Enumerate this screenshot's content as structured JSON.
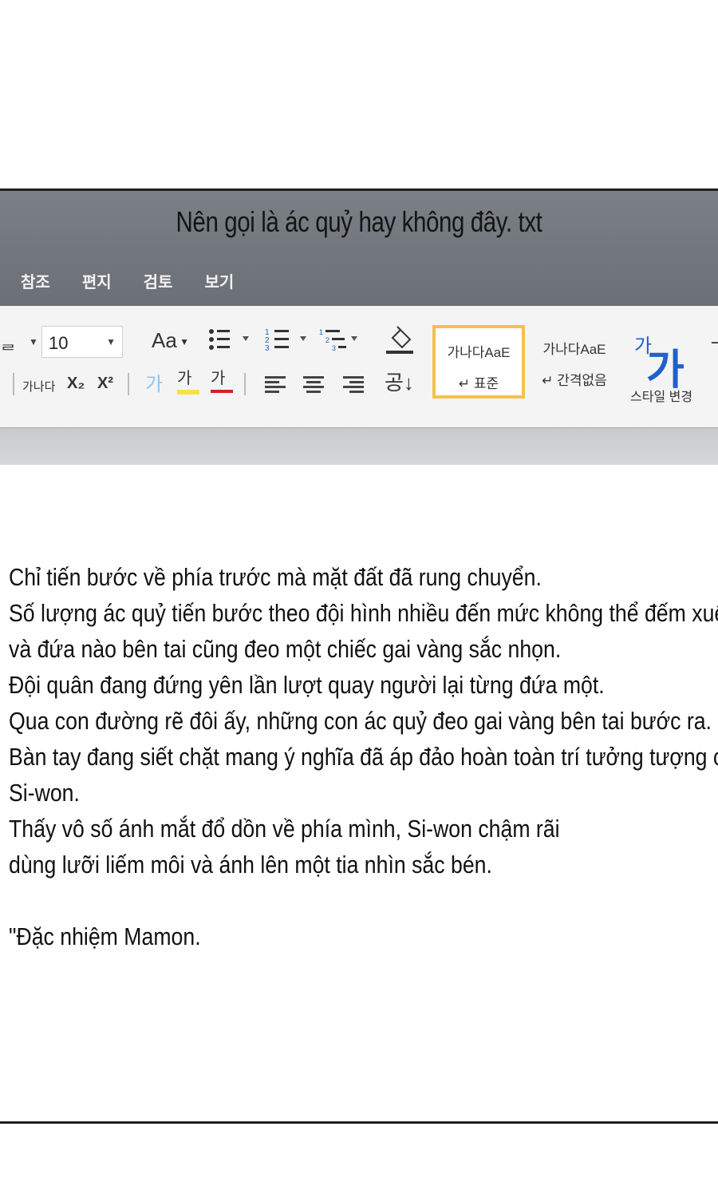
{
  "window": {
    "title": "Nên gọi là ác quỷ hay không đây. txt"
  },
  "menu": [
    "참조",
    "편지",
    "검토",
    "보기"
  ],
  "ribbon": {
    "font_size": "10",
    "font_case_label": "Aa",
    "font_name_preview": "가나다",
    "subscript": "X₂",
    "superscript": "X²",
    "char_a": "가",
    "char_b": "가",
    "char_c": "가",
    "sort_label": "공↓",
    "styles": [
      {
        "preview": "가나다AaE",
        "name": "↵ 표준",
        "active": true
      },
      {
        "preview": "가나다AaE",
        "name": "↵ 간격없음",
        "active": false
      }
    ],
    "style_change_icon_small": "가",
    "style_change_icon_big": "가",
    "style_change_label": "스타일 변경",
    "colors": {
      "highlight": "#f7e24a",
      "font_color": "#d62020",
      "style_accent": "#f2c14e",
      "link_blue": "#1e62c9"
    }
  },
  "document": {
    "lines": [
      "Chỉ tiến bước về phía trước mà mặt đất đã rung chuyển.",
      "Số lượng ác quỷ tiến bước theo đội hình nhiều đến mức không thể đếm xuể,",
      "và đứa nào bên tai cũng đeo một chiếc gai vàng sắc nhọn.",
      "Đội quân đang đứng yên lần lượt quay người lại từng đứa một.",
      "Qua con đường rẽ đôi ấy, những con ác quỷ đeo gai vàng bên tai bước ra.",
      "Bàn tay đang siết chặt mang ý nghĩa đã áp đảo hoàn toàn trí tưởng tượng của",
      "Si-won.",
      "Thấy vô số ánh mắt đổ dồn về phía mình, Si-won chậm rãi",
      "dùng lưỡi liếm môi và ánh lên một tia nhìn sắc bén."
    ],
    "last_line": "\"Đặc nhiệm Mamon."
  }
}
